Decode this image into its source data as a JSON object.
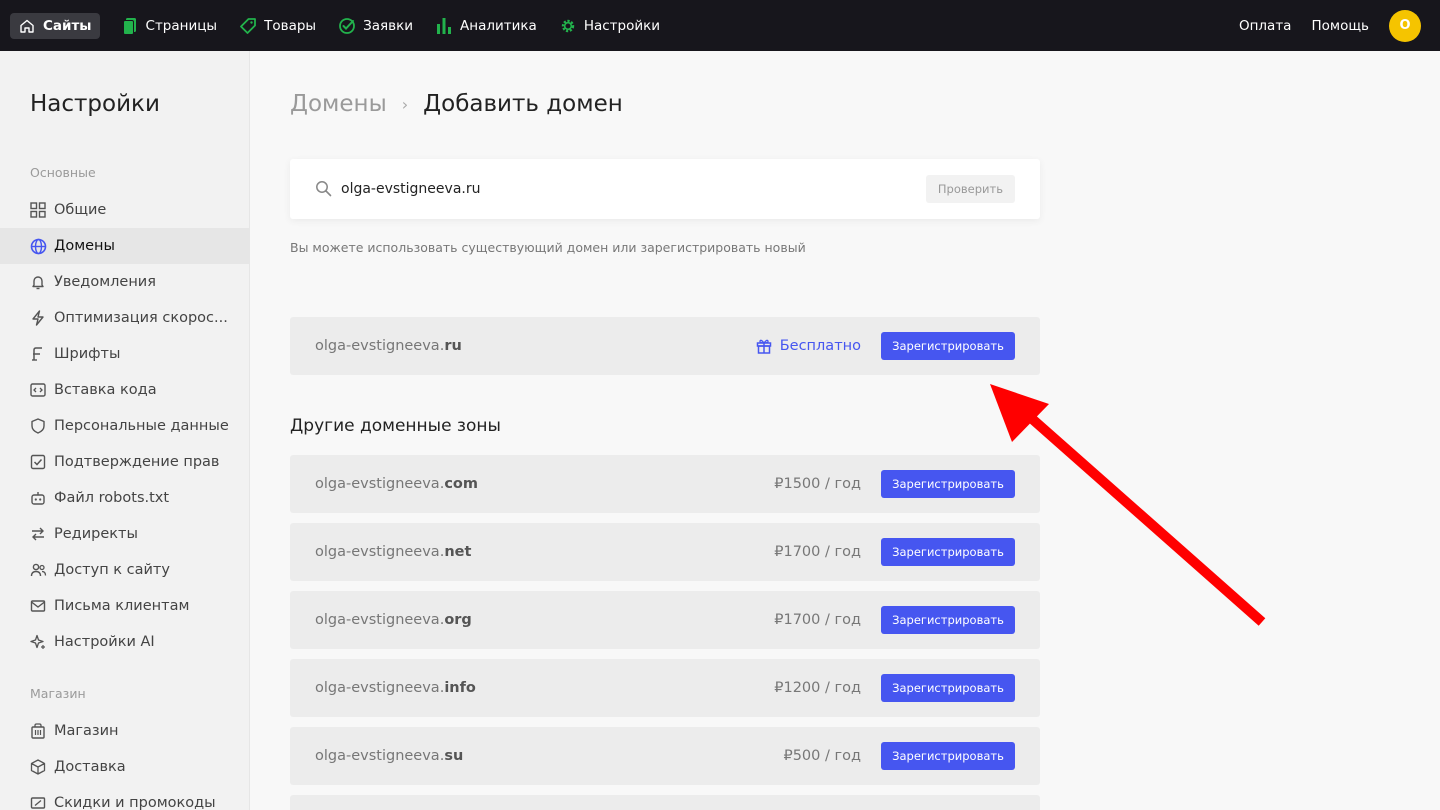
{
  "topnav": {
    "items": [
      {
        "label": "Сайты",
        "icon": "home-icon",
        "active": true
      },
      {
        "label": "Страницы",
        "icon": "pages-icon"
      },
      {
        "label": "Товары",
        "icon": "tag-icon"
      },
      {
        "label": "Заявки",
        "icon": "check-circle-icon"
      },
      {
        "label": "Аналитика",
        "icon": "bar-chart-icon"
      },
      {
        "label": "Настройки",
        "icon": "gear-icon"
      }
    ],
    "payment": "Оплата",
    "help": "Помощь",
    "avatar_letter": "O"
  },
  "sidebar": {
    "title": "Настройки",
    "section_main": "Основные",
    "items": [
      {
        "label": "Общие",
        "icon": "grid-icon"
      },
      {
        "label": "Домены",
        "icon": "globe-icon",
        "active": true
      },
      {
        "label": "Уведомления",
        "icon": "bell-icon"
      },
      {
        "label": "Оптимизация скорос...",
        "icon": "lightning-icon"
      },
      {
        "label": "Шрифты",
        "icon": "font-icon"
      },
      {
        "label": "Вставка кода",
        "icon": "code-icon"
      },
      {
        "label": "Персональные данные",
        "icon": "shield-icon"
      },
      {
        "label": "Подтверждение прав",
        "icon": "checkbox-icon"
      },
      {
        "label": "Файл robots.txt",
        "icon": "robot-icon"
      },
      {
        "label": "Редиректы",
        "icon": "redirect-icon"
      },
      {
        "label": "Доступ к сайту",
        "icon": "users-icon"
      },
      {
        "label": "Письма клиентам",
        "icon": "mail-icon"
      },
      {
        "label": "Настройки AI",
        "icon": "sparkle-icon"
      }
    ],
    "section_shop": "Магазин",
    "shop_items": [
      {
        "label": "Магазин",
        "icon": "store-icon"
      },
      {
        "label": "Доставка",
        "icon": "box-icon"
      },
      {
        "label": "Скидки и промокоды",
        "icon": "discount-icon"
      }
    ]
  },
  "breadcrumb": {
    "parent": "Домены",
    "separator": "›",
    "current": "Добавить домен"
  },
  "search": {
    "value": "olga-evstigneeva.ru",
    "check_label": "Проверить"
  },
  "hint": "Вы можете использовать существующий домен или зарегистрировать новый",
  "primary_domain": {
    "base": "olga-evstigneeva.",
    "zone": "ru",
    "price_label": "Бесплатно",
    "button": "Зарегистрировать"
  },
  "other_title": "Другие доменные зоны",
  "other_domains": [
    {
      "base": "olga-evstigneeva.",
      "zone": "com",
      "price": "₽1500 / год",
      "button": "Зарегистрировать"
    },
    {
      "base": "olga-evstigneeva.",
      "zone": "net",
      "price": "₽1700 / год",
      "button": "Зарегистрировать"
    },
    {
      "base": "olga-evstigneeva.",
      "zone": "org",
      "price": "₽1700 / год",
      "button": "Зарегистрировать"
    },
    {
      "base": "olga-evstigneeva.",
      "zone": "info",
      "price": "₽1200 / год",
      "button": "Зарегистрировать"
    },
    {
      "base": "olga-evstigneeva.",
      "zone": "su",
      "price": "₽500 / год",
      "button": "Зарегистрировать"
    }
  ],
  "colors": {
    "accent": "#4656f0",
    "topbar": "#17161c",
    "arrow": "#ff0000",
    "icon_green": "#22b24c"
  }
}
